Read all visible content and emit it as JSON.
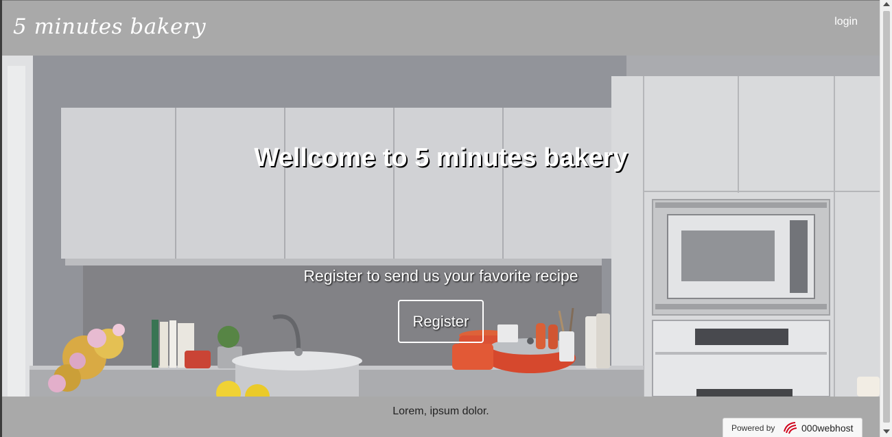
{
  "header": {
    "brand": "5 minutes bakery",
    "login_label": "login"
  },
  "hero": {
    "title": "Wellcome to 5 minutes bakery",
    "subtitle": "Register to send us your favorite recipe",
    "register_label": "Register",
    "background_icon": "kitchen-photo"
  },
  "footer": {
    "text": "Lorem, ipsum dolor."
  },
  "hosting_badge": {
    "powered_by": "Powered by",
    "brand": "000webhost"
  },
  "colors": {
    "bar_background": "#a9a9a9",
    "text_light": "#ffffff",
    "badge_logo": "#d0021b"
  }
}
